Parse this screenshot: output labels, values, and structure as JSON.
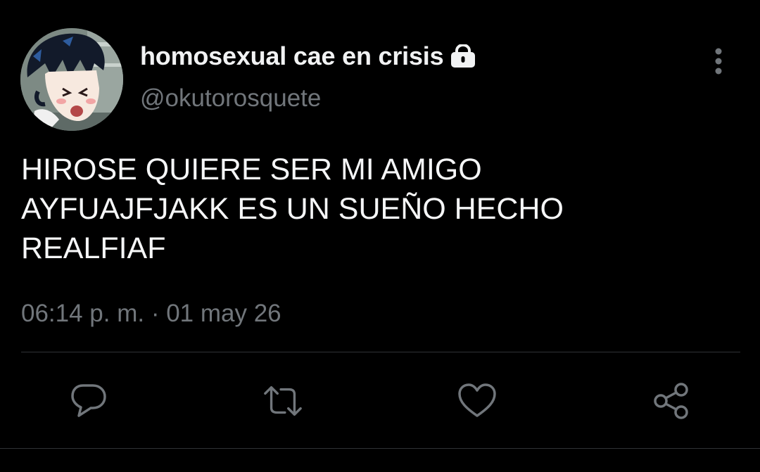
{
  "tweet": {
    "display_name": "homosexual cae en crisis",
    "handle": "@okutorosquete",
    "text": "HIROSE QUIERE SER MI AMIGO\nAYFUAJFJAKK ES UN SUEÑO HECHO\nREALFIAF",
    "timestamp": "06:14 p. m. · 01 may 26",
    "protected_icon": "lock-icon"
  },
  "actions": [
    {
      "name": "reply",
      "icon": "comment-bubble-icon"
    },
    {
      "name": "retweet",
      "icon": "retweet-arrows-icon"
    },
    {
      "name": "like",
      "icon": "heart-icon"
    },
    {
      "name": "share",
      "icon": "share-nodes-icon"
    }
  ],
  "colors": {
    "background": "#000000",
    "primary_text": "#e7e9ea",
    "secondary_text": "#71767b",
    "divider": "#2f3336"
  }
}
